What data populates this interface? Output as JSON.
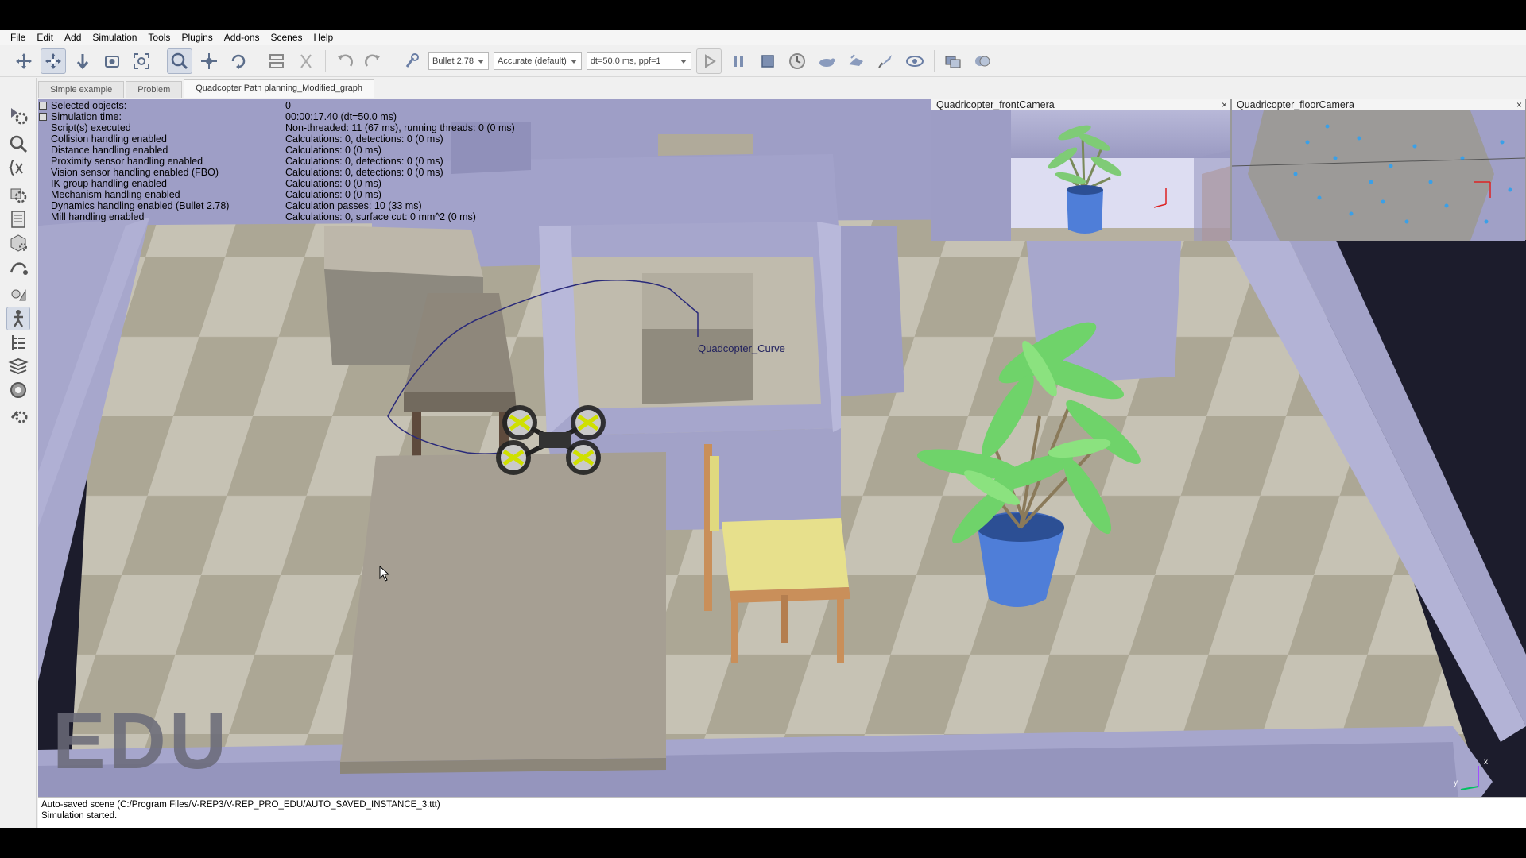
{
  "menu": [
    "File",
    "Edit",
    "Add",
    "Simulation",
    "Tools",
    "Plugins",
    "Add-ons",
    "Scenes",
    "Help"
  ],
  "toolbar": {
    "engine": "Bullet 2.78",
    "accuracy": "Accurate (default)",
    "timestep": "dt=50.0 ms, ppf=1",
    "icons": [
      "pan-icon",
      "rotate-camera-icon",
      "shift-icon",
      "fit-view-icon",
      "zoom-fit-icon",
      "object-select-icon",
      "object-shift-icon",
      "object-rotate-icon",
      "assemble-icon",
      "transfer-dna-icon",
      "undo-icon",
      "redo-icon",
      "dynamics-settings-icon",
      "play-icon",
      "pause-icon",
      "stop-icon",
      "real-time-icon",
      "slow-down-icon",
      "speed-up-icon",
      "thread-rendering-icon",
      "visualization-icon",
      "page-selector-icon",
      "scene-selector-icon"
    ]
  },
  "tabs": [
    {
      "label": "Simple example"
    },
    {
      "label": "Problem"
    },
    {
      "label": "Quadcopter Path planning_Modified_graph"
    }
  ],
  "info": {
    "rows": [
      {
        "label": "Selected objects:",
        "value": "0"
      },
      {
        "label": "Simulation time:",
        "value": "00:00:17.40 (dt=50.0 ms)"
      },
      {
        "label": "Script(s) executed",
        "value": "Non-threaded: 11 (67 ms), running threads: 0 (0 ms)"
      },
      {
        "label": "Collision handling enabled",
        "value": "Calculations: 0, detections: 0 (0 ms)"
      },
      {
        "label": "Distance handling enabled",
        "value": "Calculations: 0 (0 ms)"
      },
      {
        "label": "Proximity sensor handling enabled",
        "value": "Calculations: 0, detections: 0 (0 ms)"
      },
      {
        "label": "Vision sensor handling enabled (FBO)",
        "value": "Calculations: 0, detections: 0 (0 ms)"
      },
      {
        "label": "IK group handling enabled",
        "value": "Calculations: 0 (0 ms)"
      },
      {
        "label": "Mechanism handling enabled",
        "value": "Calculations: 0 (0 ms)"
      },
      {
        "label": "Dynamics handling enabled (Bullet 2.78)",
        "value": "Calculation passes: 10 (33 ms)"
      },
      {
        "label": "Mill handling enabled",
        "value": "Calculations: 0, surface cut: 0 mm^2 (0 ms)"
      }
    ]
  },
  "scene": {
    "curve_label": "Quadcopter_Curve",
    "watermark": "EDU",
    "axis_x": "x",
    "axis_y": "y"
  },
  "cameras": [
    {
      "title": "Quadricopter_frontCamera",
      "close": "×"
    },
    {
      "title": "Quadricopter_floorCamera",
      "close": "×"
    }
  ],
  "status": {
    "line1": "Auto-saved scene (C:/Program Files/V-REP3/V-REP_PRO_EDU/AUTO_SAVED_INSTANCE_3.ttt)",
    "line2": "Simulation started."
  },
  "colors": {
    "wall": "#9f9fc8",
    "floor_light": "#c9c4b6",
    "floor_dark": "#a9a496",
    "table": "#a79f92",
    "chair_seat": "#e3dd86",
    "chair_wood": "#c98f5a",
    "pot": "#4f7ed8",
    "leaves": "#6fd36a",
    "curve": "#2a2a7a"
  }
}
